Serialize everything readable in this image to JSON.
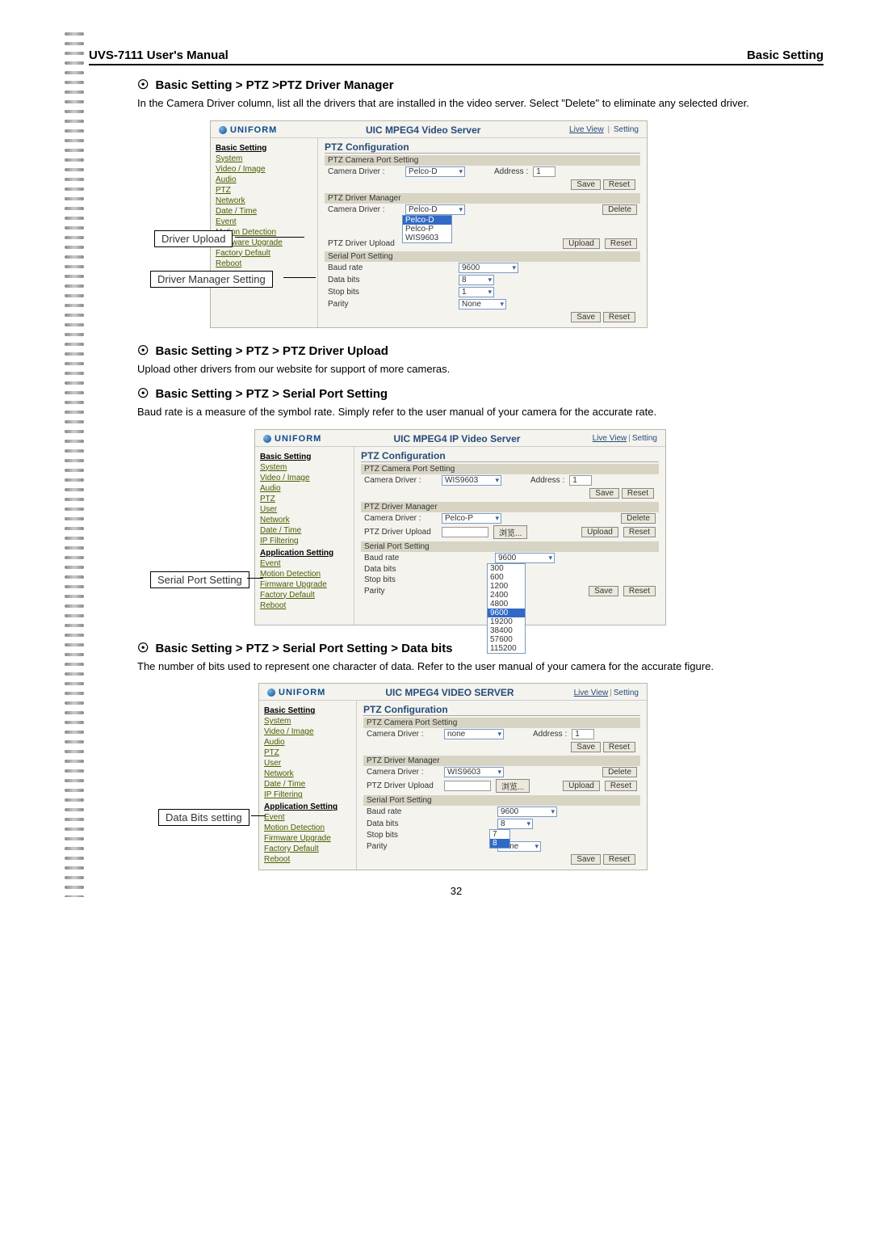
{
  "doc": {
    "header_left": "UVS-7111 User's Manual",
    "header_right": "Basic Setting",
    "page_number": "32"
  },
  "sections": {
    "s1": {
      "heading": "Basic Setting > PTZ >PTZ Driver Manager",
      "body": "In the Camera Driver column, list all the drivers that are installed in the video server. Select \"Delete\" to eliminate any selected driver."
    },
    "s2": {
      "heading": "Basic Setting > PTZ > PTZ Driver Upload",
      "body": "Upload other drivers from our website for support of more cameras."
    },
    "s3": {
      "heading": "Basic Setting > PTZ > Serial Port Setting",
      "body": "Baud rate is a measure of the symbol rate. Simply refer to the user manual of your camera for the accurate rate."
    },
    "s4": {
      "heading": "Basic Setting > PTZ > Serial Port Setting > Data bits",
      "body": "The number of bits used to represent one character of data. Refer to the user manual of your camera for the accurate figure."
    }
  },
  "callouts": {
    "driver_upload": "Driver Upload",
    "driver_manager_setting": "Driver Manager Setting",
    "serial_port_setting": "Serial Port Setting",
    "data_bits_setting": "Data Bits setting"
  },
  "shot_common": {
    "logo": "UNIFORM",
    "links_live": "Live View",
    "links_setting": "Setting",
    "panel_title": "PTZ Configuration",
    "sub_camport": "PTZ Camera Port Setting",
    "sub_drvmgr": "PTZ Driver Manager",
    "sub_upload": "PTZ Driver Upload",
    "sub_serial": "Serial Port Setting",
    "lbl_camdriver": "Camera Driver :",
    "lbl_address": "Address :",
    "lbl_baud": "Baud rate",
    "lbl_databits": "Data bits",
    "lbl_stopbits": "Stop bits",
    "lbl_parity": "Parity",
    "btn_save": "Save",
    "btn_reset": "Reset",
    "btn_delete": "Delete",
    "btn_upload": "Upload",
    "btn_browse": "浏览..."
  },
  "sidebar": {
    "basic_setting": "Basic Setting",
    "items": [
      "System",
      "Video / Image",
      "Audio",
      "PTZ",
      "User",
      "Network",
      "Date / Time",
      "IP Filtering"
    ],
    "app_setting": "Application Setting",
    "items2": [
      "Event",
      "Motion Detection",
      "Firmware Upgrade",
      "Factory Default",
      "Reboot"
    ]
  },
  "shot1": {
    "title": "UIC MPEG4 Video Server",
    "camdriver_port": "Pelco-D",
    "address": "1",
    "camdriver_mgr": "Pelco-D",
    "dropdown_options": [
      "Pelco-D",
      "Pelco-P",
      "WIS9603"
    ],
    "baud": "9600",
    "databits": "8",
    "stopbits": "1",
    "parity": "None",
    "sidebar_items": [
      "System",
      "Video / Image",
      "Audio",
      "PTZ",
      "Network",
      "Date / Time"
    ],
    "sidebar_items2": [
      "Event",
      "Motion Detection",
      "Firmware Upgrade",
      "Factory Default",
      "Reboot"
    ]
  },
  "shot2": {
    "title": "UIC MPEG4 IP Video Server",
    "camdriver_port": "WIS9603",
    "address": "1",
    "camdriver_mgr": "Pelco-P",
    "baud": "9600",
    "baud_options": [
      "300",
      "600",
      "1200",
      "2400",
      "4800",
      "9600",
      "19200",
      "38400",
      "57600",
      "115200"
    ],
    "databits_blank": "",
    "stopbits_blank": "",
    "parity_blank": ""
  },
  "shot3": {
    "title": "UIC MPEG4 VIDEO SERVER",
    "camdriver_port": "none",
    "address": "1",
    "camdriver_mgr": "WIS9603",
    "baud": "9600",
    "databits_sel": "8",
    "databits_options": [
      "7",
      "8"
    ],
    "stopbits_blank": "",
    "parity": "none"
  }
}
